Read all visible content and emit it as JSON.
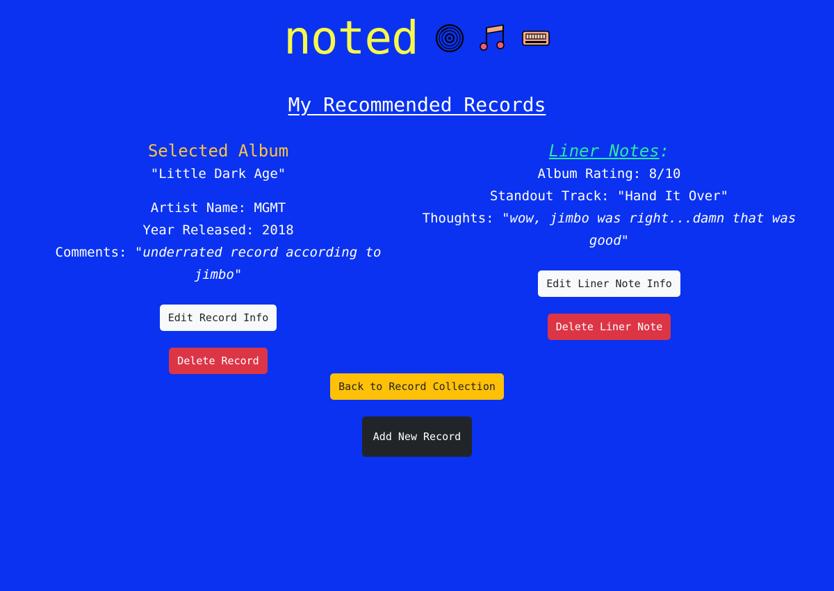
{
  "header": {
    "logo": "noted",
    "icons": [
      "vinyl-record-icon",
      "music-note-icon",
      "cassette-tape-icon"
    ]
  },
  "page_title": "My Recommended Records",
  "selected_album": {
    "heading": "Selected Album",
    "album_name": "\"Little Dark Age\"",
    "artist_label": "Artist Name: ",
    "artist_value": "MGMT",
    "year_label": "Year Released: ",
    "year_value": "2018",
    "comments_label": "Comments: ",
    "comments_value": "\"underrated record according to jimbo\"",
    "edit_button": "Edit Record Info",
    "delete_button": "Delete Record"
  },
  "liner_notes": {
    "heading": "Liner Notes",
    "heading_suffix": ":",
    "rating_label": "Album Rating: ",
    "rating_value": "8/10",
    "track_label": "Standout Track: ",
    "track_value": "\"Hand It Over\"",
    "thoughts_label": "Thoughts: ",
    "thoughts_value": "\"wow, jimbo was right...damn that was good\"",
    "edit_button": "Edit Liner Note Info",
    "delete_button": "Delete Liner Note"
  },
  "actions": {
    "back_button": "Back to Record Collection",
    "add_button": "Add New Record"
  },
  "colors": {
    "background": "#0a32f0",
    "logo": "#f8f84a",
    "selected_heading": "#f7c542",
    "liner_heading": "#2ee8a0",
    "danger": "#dc3545",
    "warning": "#ffc107",
    "dark": "#212529"
  }
}
